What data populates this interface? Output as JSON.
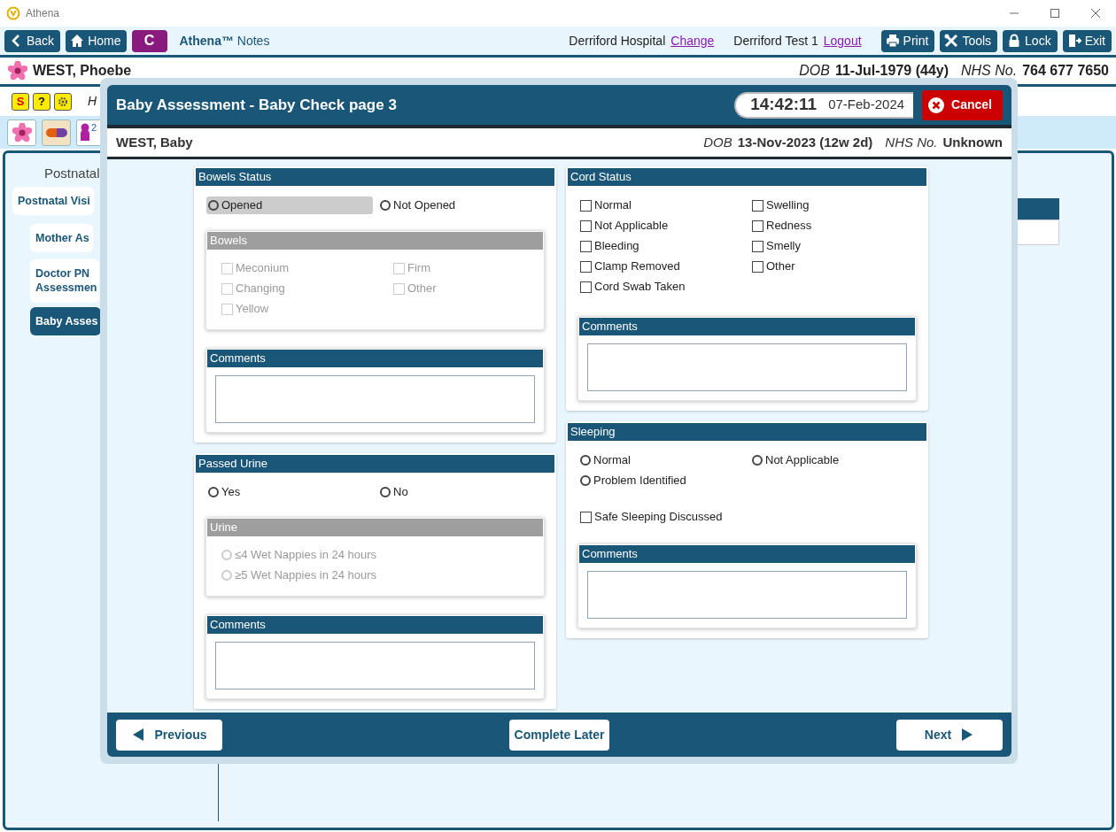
{
  "app": {
    "title": "Athena"
  },
  "toolbar": {
    "left_buttons": [
      {
        "kind": "back",
        "label": "Back"
      },
      {
        "kind": "home",
        "label": "Home"
      },
      {
        "kind": "letter",
        "label": "C"
      }
    ],
    "brand": "**Athena™** Notes",
    "location": "Derriford Hospital",
    "location_link": "Change",
    "user": "Derriford Test 1",
    "user_link": "Logout",
    "right_buttons": [
      {
        "kind": "print",
        "label": "Print"
      },
      {
        "kind": "tools",
        "label": "Tools"
      },
      {
        "kind": "lock",
        "label": "Lock"
      },
      {
        "kind": "exit",
        "label": "Exit"
      }
    ]
  },
  "patient": {
    "name": "WEST, Phoebe",
    "dob_label": "DOB",
    "dob": "11-Jul-1979 (44y)",
    "nhs_label": "NHS No.",
    "nhs": "764 677 7650"
  },
  "alert_icons": [
    {
      "kind": "sign",
      "glyph": "S"
    },
    {
      "kind": "help",
      "glyph": "?"
    },
    {
      "kind": "gear"
    }
  ],
  "alert_text": "H",
  "record_icons": [
    {
      "kind": "flower",
      "selected": false
    },
    {
      "kind": "pill",
      "selected": true
    },
    {
      "kind": "baby",
      "count": "2",
      "selected": false
    }
  ],
  "nav": {
    "heading": "Postnatal",
    "items": [
      {
        "label": "Postnatal Visi",
        "selected": false,
        "children": [
          {
            "label": "Mother As",
            "selected": false
          },
          {
            "label": "Doctor PN Assessmen",
            "selected": false
          },
          {
            "label": "Baby Asses",
            "selected": true
          }
        ]
      }
    ]
  },
  "modal": {
    "title": "Baby Assessment - Baby Check page 3",
    "time": "14:42:11",
    "date": "07-Feb-2024",
    "cancel": "Cancel",
    "patient": {
      "name": "WEST, Baby",
      "dob_label": "DOB",
      "dob": "13-Nov-2023 (12w 2d)",
      "nhs_label": "NHS No.",
      "nhs": "Unknown"
    },
    "columns": [
      [
        {
          "title": "Bowels Status",
          "options": [
            {
              "kind": "radio",
              "label": "Opened",
              "checked": false,
              "highlighted": true
            },
            {
              "kind": "radio",
              "label": "Not Opened",
              "checked": false,
              "highlighted": false
            }
          ],
          "subgroup": {
            "title": "Bowels",
            "disabled": true,
            "options": [
              {
                "kind": "checkbox",
                "label": "Meconium",
                "checked": false
              },
              {
                "kind": "checkbox",
                "label": "Firm",
                "checked": false
              },
              {
                "kind": "checkbox",
                "label": "Changing",
                "checked": false
              },
              {
                "kind": "checkbox",
                "label": "Other",
                "checked": false
              },
              {
                "kind": "checkbox",
                "label": "Yellow",
                "checked": false
              }
            ]
          },
          "comments": {
            "title": "Comments"
          }
        },
        {
          "title": "Passed Urine",
          "options": [
            {
              "kind": "radio",
              "label": "Yes",
              "checked": false,
              "highlighted": false
            },
            {
              "kind": "radio",
              "label": "No",
              "checked": false,
              "highlighted": false
            }
          ],
          "subgroup": {
            "title": "Urine",
            "disabled": true,
            "options": [
              {
                "kind": "radio",
                "label": "≤4 Wet Nappies in 24 hours",
                "checked": false
              },
              {
                "kind": "radio",
                "label": "≥5 Wet Nappies in 24 hours",
                "checked": false
              }
            ]
          },
          "comments": {
            "title": "Comments"
          }
        }
      ],
      [
        {
          "title": "Cord Status",
          "options": [
            {
              "kind": "checkbox",
              "label": "Normal",
              "checked": false
            },
            {
              "kind": "checkbox",
              "label": "Swelling",
              "checked": false
            },
            {
              "kind": "checkbox",
              "label": "Not Applicable",
              "checked": false
            },
            {
              "kind": "checkbox",
              "label": "Redness",
              "checked": false
            },
            {
              "kind": "checkbox",
              "label": "Bleeding",
              "checked": false
            },
            {
              "kind": "checkbox",
              "label": "Smelly",
              "checked": false
            },
            {
              "kind": "checkbox",
              "label": "Clamp Removed",
              "checked": false
            },
            {
              "kind": "checkbox",
              "label": "Other",
              "checked": false
            },
            {
              "kind": "checkbox",
              "label": "Cord Swab Taken",
              "checked": false
            }
          ],
          "comments": {
            "title": "Comments"
          }
        },
        {
          "title": "Sleeping",
          "options": [
            {
              "kind": "radio",
              "label": "Normal",
              "checked": false,
              "highlighted": false
            },
            {
              "kind": "radio",
              "label": "Not Applicable",
              "checked": false,
              "highlighted": false
            },
            {
              "kind": "radio",
              "label": "Problem Identified",
              "checked": false,
              "highlighted": false
            }
          ],
          "extras": [
            {
              "kind": "checkbox",
              "label": "Safe Sleeping Discussed",
              "checked": false
            }
          ],
          "comments": {
            "title": "Comments"
          }
        }
      ]
    ],
    "footer": {
      "previous": "Previous",
      "complete": "Complete Later",
      "next": "Next"
    }
  }
}
